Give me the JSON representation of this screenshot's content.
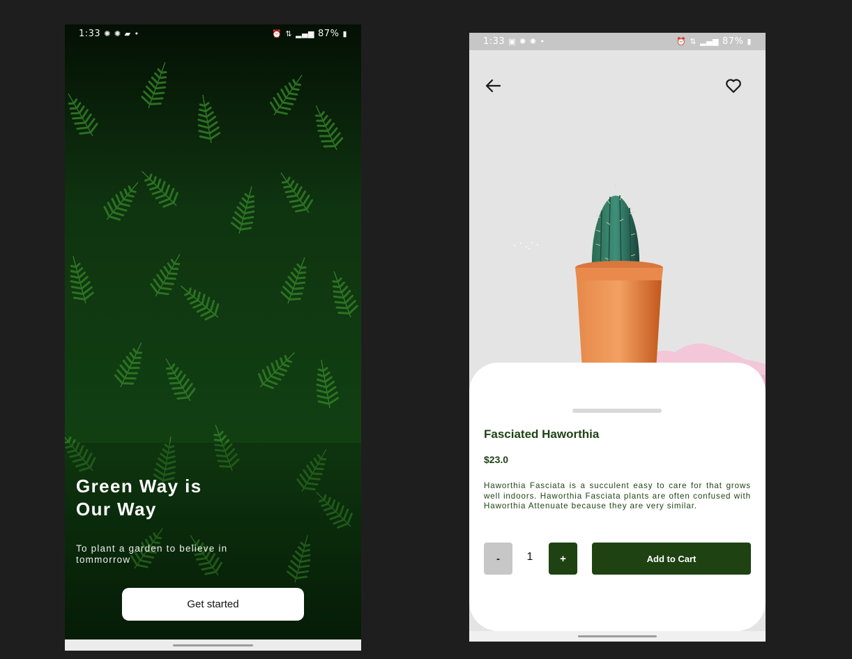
{
  "colors": {
    "page_background": "#1f1e1f",
    "brand_green": "#1e4212",
    "text_green": "#1f4214",
    "minus_button_gray": "#c7c7c7",
    "hero_background": "#0b1f0c"
  },
  "left_screen": {
    "status_bar": {
      "time": "1:33",
      "battery": "87%",
      "left_icons": [
        "sync-icon",
        "sync-icon",
        "message-icon",
        "dot-icon"
      ],
      "right_icons": [
        "alarm-icon",
        "data-icon",
        "signal-icon",
        "battery-icon"
      ]
    },
    "background_image": "fern-leaves-image",
    "title": "Green Way is Our Way",
    "title_line1": "Green Way is",
    "title_line2": "Our Way",
    "subtitle": "To plant a garden to believe in tommorrow",
    "cta_label": "Get started"
  },
  "right_screen": {
    "status_bar": {
      "time": "1:33",
      "battery": "87%",
      "left_icons": [
        "image-icon",
        "sync-icon",
        "sync-icon",
        "dot-icon"
      ],
      "right_icons": [
        "alarm-icon",
        "data-icon",
        "signal-icon",
        "battery-icon"
      ]
    },
    "header": {
      "back_icon": "arrow-left-icon",
      "favorite_icon": "heart-outline-icon"
    },
    "product_image": "cactus-in-terracotta-pot",
    "product": {
      "name": "Fasciated Haworthia",
      "price": "$23.0",
      "description": "Haworthia Fasciata is a succulent easy to care for that grows well indoors. Haworthia Fasciata plants are often confused with Haworthia Attenuate because they are very similar."
    },
    "quantity": {
      "minus_label": "-",
      "value": "1",
      "plus_label": "+"
    },
    "add_to_cart_label": "Add to Cart"
  }
}
